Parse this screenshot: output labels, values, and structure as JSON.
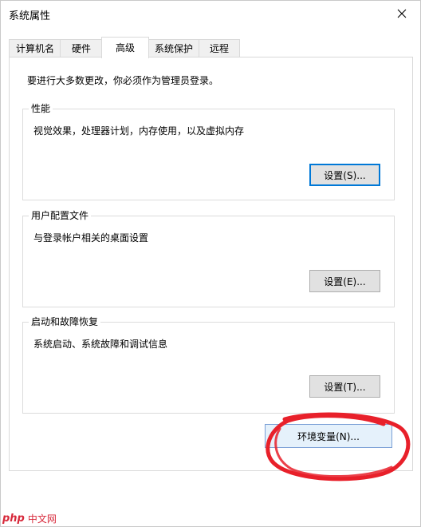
{
  "window": {
    "title": "系统属性"
  },
  "tabs": [
    {
      "label": "计算机名"
    },
    {
      "label": "硬件"
    },
    {
      "label": "高级",
      "active": true
    },
    {
      "label": "系统保护"
    },
    {
      "label": "远程"
    }
  ],
  "admin_note": "要进行大多数更改，你必须作为管理员登录。",
  "groups": {
    "performance": {
      "title": "性能",
      "description": "视觉效果，处理器计划，内存使用，以及虚拟内存",
      "button": "设置(S)..."
    },
    "user_profiles": {
      "title": "用户配置文件",
      "description": "与登录帐户相关的桌面设置",
      "button": "设置(E)..."
    },
    "startup_recovery": {
      "title": "启动和故障恢复",
      "description": "系统启动、系统故障和调试信息",
      "button": "设置(T)..."
    }
  },
  "env_button": "环境变量(N)...",
  "annotation_color": "#e8202a",
  "watermark": {
    "logo": "php",
    "text": "中文网"
  }
}
